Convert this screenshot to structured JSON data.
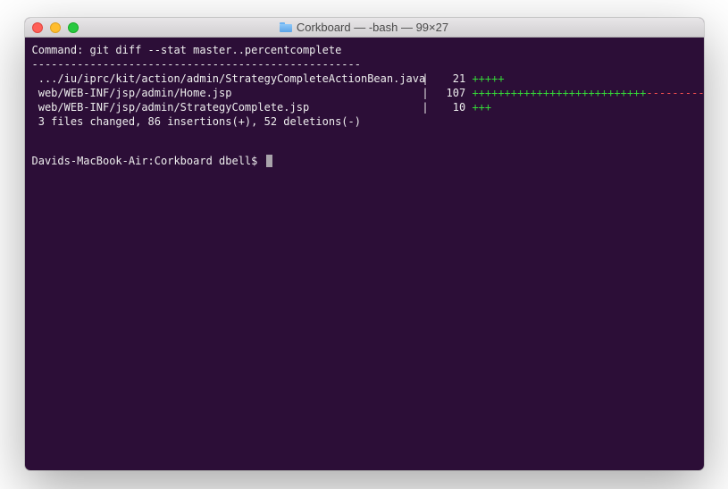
{
  "window": {
    "title": "Corkboard — -bash — 99×27"
  },
  "command": {
    "label": "Command:",
    "text": "git diff --stat master..percentcomplete"
  },
  "rule": "---------------------------------------------------",
  "diff": {
    "rows": [
      {
        "path": ".../iu/iprc/kit/action/admin/StrategyCompleteActionBean.java",
        "count": "21",
        "plus": "+++++",
        "minus": ""
      },
      {
        "path": "web/WEB-INF/jsp/admin/Home.jsp",
        "count": "107",
        "plus": "+++++++++++++++++++++++++++",
        "minus": "-------------"
      },
      {
        "path": "web/WEB-INF/jsp/admin/StrategyComplete.jsp",
        "count": "10",
        "plus": "+++",
        "minus": ""
      }
    ],
    "summary": "3 files changed, 86 insertions(+), 52 deletions(-)"
  },
  "prompt": "Davids-MacBook-Air:Corkboard dbell$"
}
